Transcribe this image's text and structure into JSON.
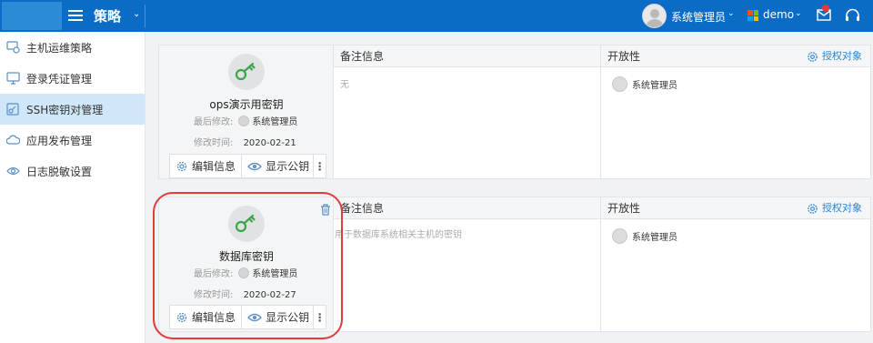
{
  "header": {
    "app_title": "策略",
    "user_name": "系统管理员",
    "tenant": "demo"
  },
  "sidebar": {
    "items": [
      {
        "label": "主机运维策略",
        "icon": "host-policy-icon"
      },
      {
        "label": "登录凭证管理",
        "icon": "monitor-credential-icon"
      },
      {
        "label": "SSH密钥对管理",
        "icon": "ssh-key-icon",
        "active": true
      },
      {
        "label": "应用发布管理",
        "icon": "cloud-app-icon"
      },
      {
        "label": "日志脱敏设置",
        "icon": "eye-icon"
      }
    ]
  },
  "columns": {
    "remark": "备注信息",
    "openness": "开放性",
    "auth": "授权对象"
  },
  "labels": {
    "last_modifier": "最后修改:",
    "modified_time": "修改时间:",
    "edit": "编辑信息",
    "show_pubkey": "显示公钥",
    "more": "⋮"
  },
  "keys": [
    {
      "name": "ops演示用密钥",
      "modifier": "系统管理员",
      "time": "2020-02-21",
      "remark": "无",
      "open_user": "系统管理员"
    },
    {
      "name": "数据库密钥",
      "modifier": "系统管理员",
      "time": "2020-02-27",
      "remark": "用于数据库系统相关主机的密钥",
      "open_user": "系统管理员"
    }
  ],
  "colors": {
    "topbar": "#0a6cc4",
    "accent": "#2b84d3",
    "key_green": "#3aa84a",
    "highlight": "#e23b3b"
  }
}
